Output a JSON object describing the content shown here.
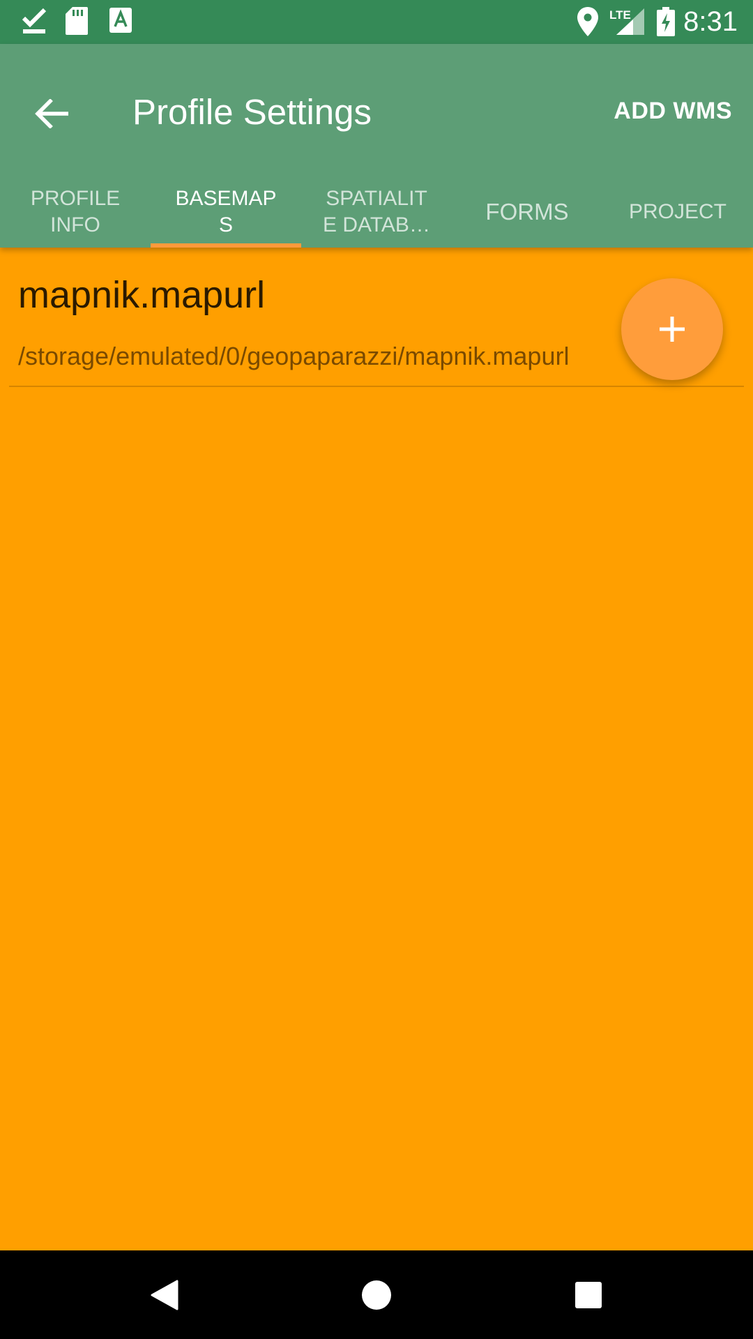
{
  "status_bar": {
    "time": "8:31",
    "network_label": "LTE",
    "icons": [
      "download-done-icon",
      "sd-card-icon",
      "font-icon",
      "location-icon",
      "signal-icon",
      "battery-charging-icon"
    ]
  },
  "app_bar": {
    "title": "Profile Settings",
    "action_label": "ADD WMS",
    "back_icon": "arrow-back-icon"
  },
  "tabs": [
    {
      "label": "PROFILE\nINFO",
      "active": false
    },
    {
      "label": "BASEMAP\nS",
      "active": true
    },
    {
      "label": "SPATIALIT\nE DATAB…",
      "active": false
    },
    {
      "label": "FORMS",
      "active": false
    },
    {
      "label": "PROJECT",
      "active": false
    }
  ],
  "basemaps": [
    {
      "title": "mapnik.mapurl",
      "path": "/storage/emulated/0/geopaparazzi/mapnik.mapurl"
    }
  ],
  "fab": {
    "icon": "plus-icon"
  },
  "nav_bar": {
    "icons": [
      "back-triangle-icon",
      "home-circle-icon",
      "recents-square-icon"
    ]
  },
  "colors": {
    "status_bar": "#358a57",
    "app_bar": "#5d9e76",
    "background": "#ff9f00",
    "accent": "#ff9d3b"
  }
}
